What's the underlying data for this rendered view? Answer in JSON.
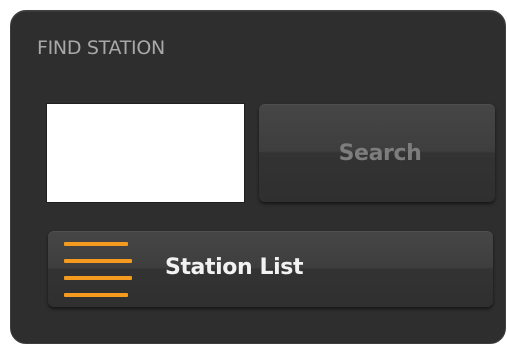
{
  "panel": {
    "title": "FIND STATION"
  },
  "search": {
    "input_value": "",
    "button_label": "Search"
  },
  "station_list": {
    "button_label": "Station List",
    "icon": "list-icon",
    "icon_color": "#f39a1f"
  }
}
